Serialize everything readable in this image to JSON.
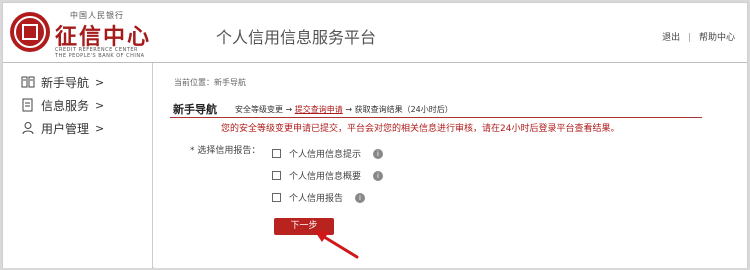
{
  "header": {
    "logo_top_text": "中国人民银行",
    "logo_main_text": "征信中心",
    "logo_en_line1": "CREDIT REFERENCE CENTER",
    "logo_en_line2": "THE PEOPLE'S BANK OF CHINA",
    "platform_title": "个人信用信息服务平台",
    "logout_label": "退出",
    "separator": "|",
    "help_label": "帮助中心"
  },
  "sidebar": {
    "items": [
      {
        "label": "新手导航",
        "arrow": ">",
        "icon": "book-icon"
      },
      {
        "label": "信息服务",
        "arrow": ">",
        "icon": "document-icon"
      },
      {
        "label": "用户管理",
        "arrow": ">",
        "icon": "user-icon"
      }
    ]
  },
  "main": {
    "breadcrumb": "当前位置：新手导航",
    "guide_title": "新手导航",
    "steps": {
      "step1": "安全等级变更",
      "arrow1": " → ",
      "step2": "提交查询申请",
      "arrow2": " → ",
      "step3": "获取查询结果（24小时后）"
    },
    "notice": "您的安全等级变更申请已提交，平台会对您的相关信息进行审核，请在24小时后登录平台查看结果。",
    "form_label": "* 选择信用报告：",
    "options": [
      {
        "label": "个人信用信息提示",
        "info": "i"
      },
      {
        "label": "个人信用信息概要",
        "info": "i"
      },
      {
        "label": "个人信用报告",
        "info": "i"
      }
    ],
    "next_button": "下一步"
  },
  "colors": {
    "brand_red": "#b01c1c",
    "button_red": "#b8221f"
  }
}
